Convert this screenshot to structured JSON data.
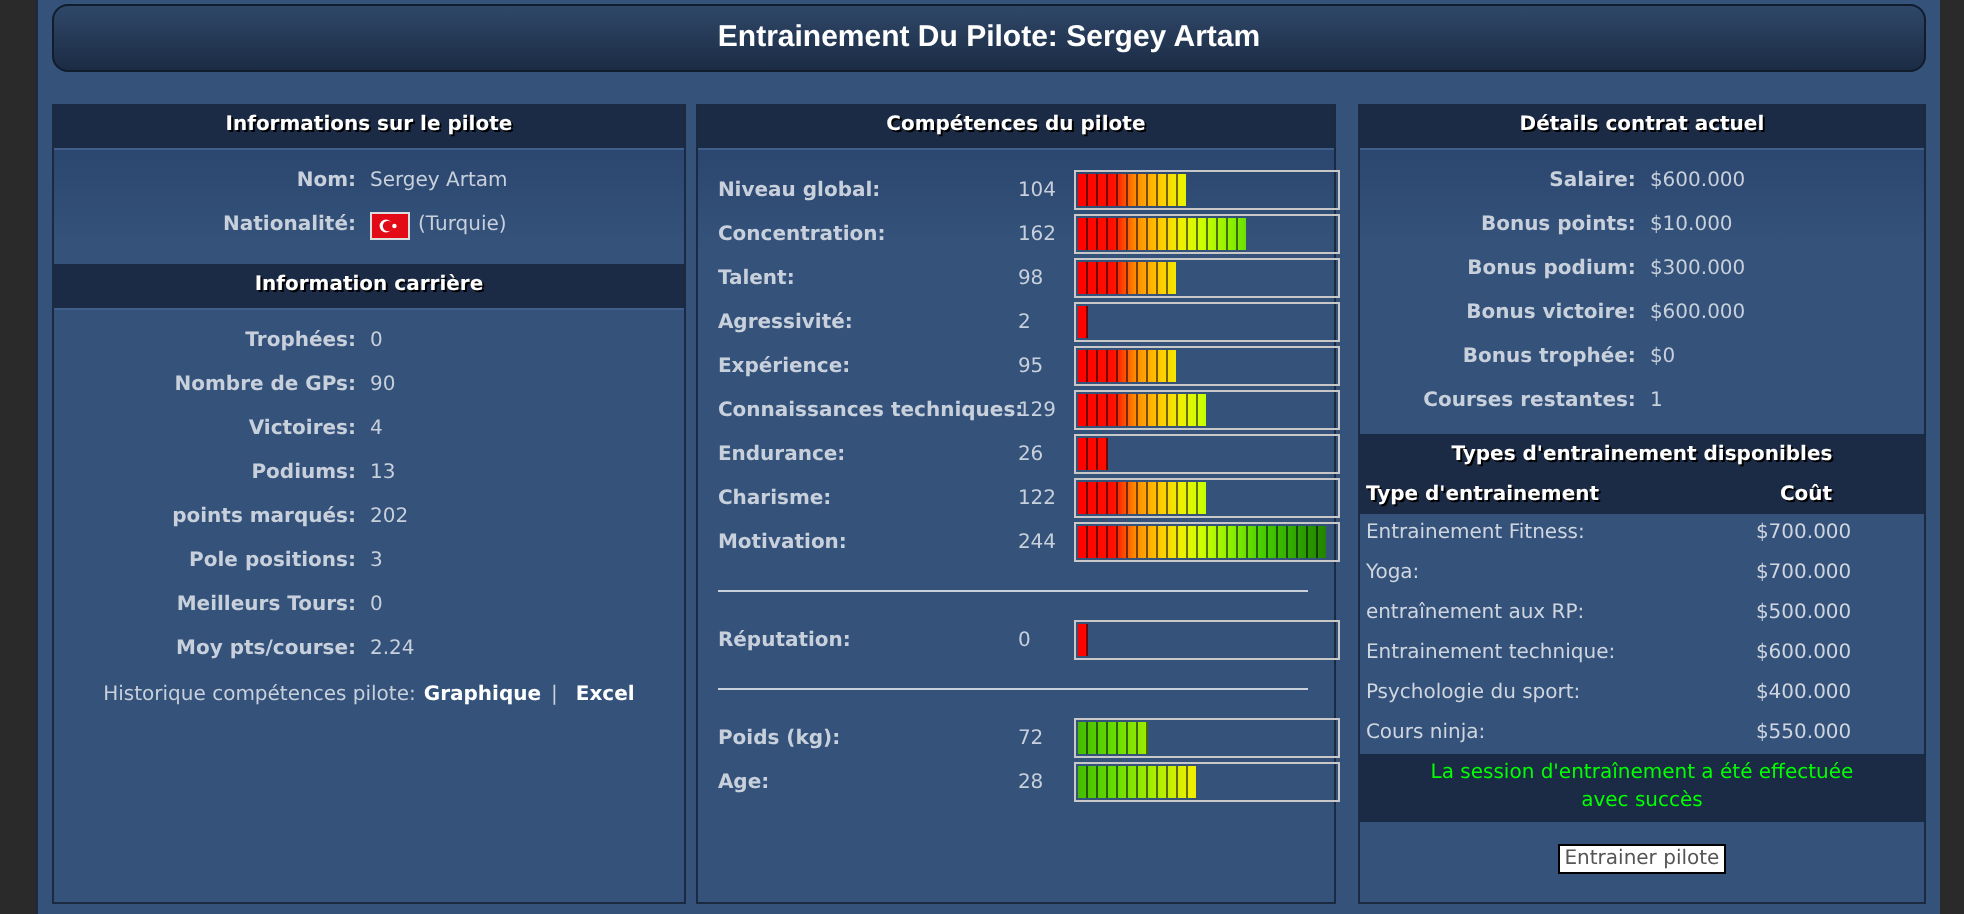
{
  "title": "Entrainement Du Pilote: Sergey Artam",
  "driver_panel": {
    "title": "Informations sur le pilote",
    "identity": [
      {
        "label": "Nom:",
        "value": "Sergey Artam"
      },
      {
        "label": "Nationalité:",
        "value": "(Turquie)",
        "kind": "flag"
      }
    ],
    "career_title": "Information carrière",
    "career": [
      {
        "label": "Trophées:",
        "value": "0"
      },
      {
        "label": "Nombre de GPs:",
        "value": "90"
      },
      {
        "label": "Victoires:",
        "value": "4"
      },
      {
        "label": "Podiums:",
        "value": "13"
      },
      {
        "label": "points marqués:",
        "value": "202"
      },
      {
        "label": "Pole positions:",
        "value": "3"
      },
      {
        "label": "Meilleurs Tours:",
        "value": "0"
      },
      {
        "label": "Moy pts/course:",
        "value": "2.24"
      }
    ],
    "history": {
      "label": "Historique compétences pilote:",
      "links": [
        "Graphique",
        "Excel"
      ],
      "separator": "|"
    }
  },
  "skills_panel": {
    "title": "Compétences du pilote",
    "groups": [
      [
        {
          "label": "Niveau global:",
          "value": "104",
          "kind": "skill",
          "level": 0.42
        },
        {
          "label": "Concentration:",
          "value": "162",
          "kind": "skill",
          "level": 0.65
        },
        {
          "label": "Talent:",
          "value": "98",
          "kind": "skill",
          "level": 0.38
        },
        {
          "label": "Agressivité:",
          "value": "2",
          "kind": "skill",
          "level": 0.04
        },
        {
          "label": "Expérience:",
          "value": "95",
          "kind": "skill",
          "level": 0.38
        },
        {
          "label": "Connaissances techniques:",
          "value": "129",
          "kind": "skill",
          "level": 0.5
        },
        {
          "label": "Endurance:",
          "value": "26",
          "kind": "skill",
          "level": 0.12
        },
        {
          "label": "Charisme:",
          "value": "122",
          "kind": "skill",
          "level": 0.5
        },
        {
          "label": "Motivation:",
          "value": "244",
          "kind": "skill",
          "level": 0.96
        }
      ],
      [
        {
          "label": "Réputation:",
          "value": "0",
          "kind": "skill",
          "level": 0.04
        }
      ],
      [
        {
          "label": "Poids (kg):",
          "value": "72",
          "kind": "physique",
          "level": 0.27
        },
        {
          "label": "Age:",
          "value": "28",
          "kind": "physique",
          "level": 0.46
        }
      ]
    ]
  },
  "contract_panel": {
    "title": "Détails contrat actuel",
    "rows": [
      {
        "label": "Salaire:",
        "value": "$600.000"
      },
      {
        "label": "Bonus points:",
        "value": "$10.000"
      },
      {
        "label": "Bonus podium:",
        "value": "$300.000"
      },
      {
        "label": "Bonus victoire:",
        "value": "$600.000"
      },
      {
        "label": "Bonus trophée:",
        "value": "$0"
      },
      {
        "label": "Courses restantes:",
        "value": "1"
      }
    ],
    "training_title": "Types d'entrainement disponibles",
    "training_columns": [
      "Type d'entrainement",
      "Coût"
    ],
    "training": [
      {
        "type": "Entrainement Fitness:",
        "cost": "$700.000"
      },
      {
        "type": "Yoga:",
        "cost": "$700.000"
      },
      {
        "type": "entraînement aux RP:",
        "cost": "$500.000"
      },
      {
        "type": "Entrainement technique:",
        "cost": "$600.000"
      },
      {
        "type": "Psychologie du sport:",
        "cost": "$400.000"
      },
      {
        "type": "Cours ninja:",
        "cost": "$550.000"
      }
    ],
    "message": "La session d'entraînement a été effectuée avec succès",
    "button": "Entrainer pilote"
  }
}
